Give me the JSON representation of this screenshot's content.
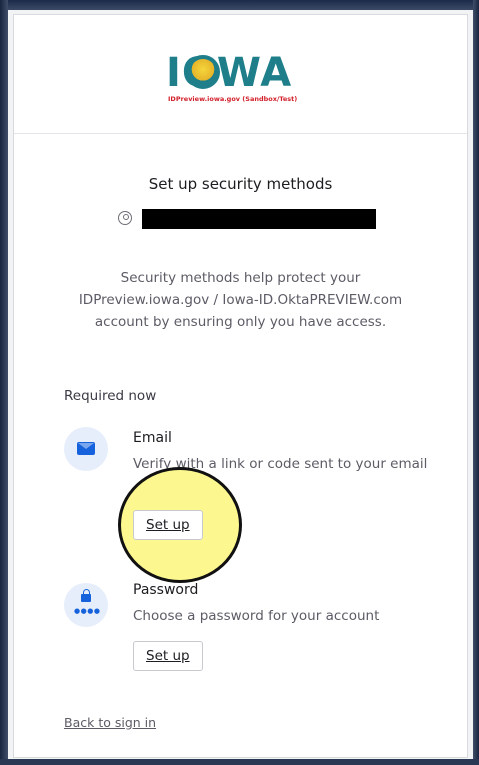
{
  "logo": {
    "letters": "IOWA",
    "subtitle": "IDPreview.iowa.gov (Sandbox/Test)"
  },
  "page": {
    "title": "Set up security methods",
    "description": "Security methods help protect your IDPreview.iowa.gov / Iowa-ID.OktaPREVIEW.com account by ensuring only you have access.",
    "section_label": "Required now",
    "back_link": "Back to sign in"
  },
  "methods": [
    {
      "icon": "envelope-icon",
      "name": "Email",
      "description": "Verify with a link or code sent to your email",
      "button": "Set up"
    },
    {
      "icon": "password-lock-icon",
      "name": "Password",
      "description": "Choose a password for your account",
      "button": "Set up"
    }
  ],
  "colors": {
    "accent": "#1662dd",
    "logo_teal": "#1e7f8a",
    "logo_sun": "#f5d63c",
    "logo_subtitle": "#d21f2a",
    "highlight": "#fcf578"
  }
}
